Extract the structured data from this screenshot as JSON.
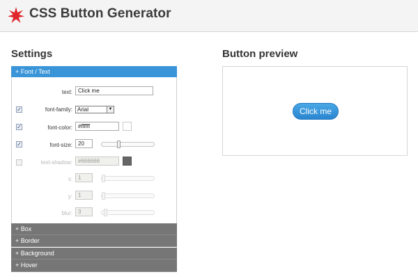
{
  "header": {
    "title": "CSS Button Generator"
  },
  "settings": {
    "title": "Settings",
    "active_section": "+ Font / Text",
    "fields": {
      "text": {
        "label": "text:",
        "value": "Click me"
      },
      "font_family": {
        "label": "font-family:",
        "value": "Arial",
        "checked": true
      },
      "font_color": {
        "label": "font-color:",
        "value": "#ffffff",
        "checked": true
      },
      "font_size": {
        "label": "font-size:",
        "value": "20",
        "checked": true
      },
      "text_shadow": {
        "label": "text-shadow:",
        "value": "#666666",
        "checked": false
      },
      "x": {
        "label": "x:",
        "value": "1"
      },
      "y": {
        "label": "y:",
        "value": "1"
      },
      "blur": {
        "label": "blur:",
        "value": "3"
      }
    },
    "collapsed_sections": [
      "+ Box",
      "+ Border",
      "+ Background",
      "+ Hover"
    ]
  },
  "preview": {
    "title": "Button preview",
    "button_label": "Click me"
  },
  "colors": {
    "accent": "#3a95d8",
    "section_header": "#767676",
    "preview_button": "#2a85cf",
    "logo": "#e0242c",
    "shadow_swatch": "#666666"
  },
  "icons": {
    "logo": "red-star-logo-icon",
    "dropdown": "chevron-down-icon"
  }
}
